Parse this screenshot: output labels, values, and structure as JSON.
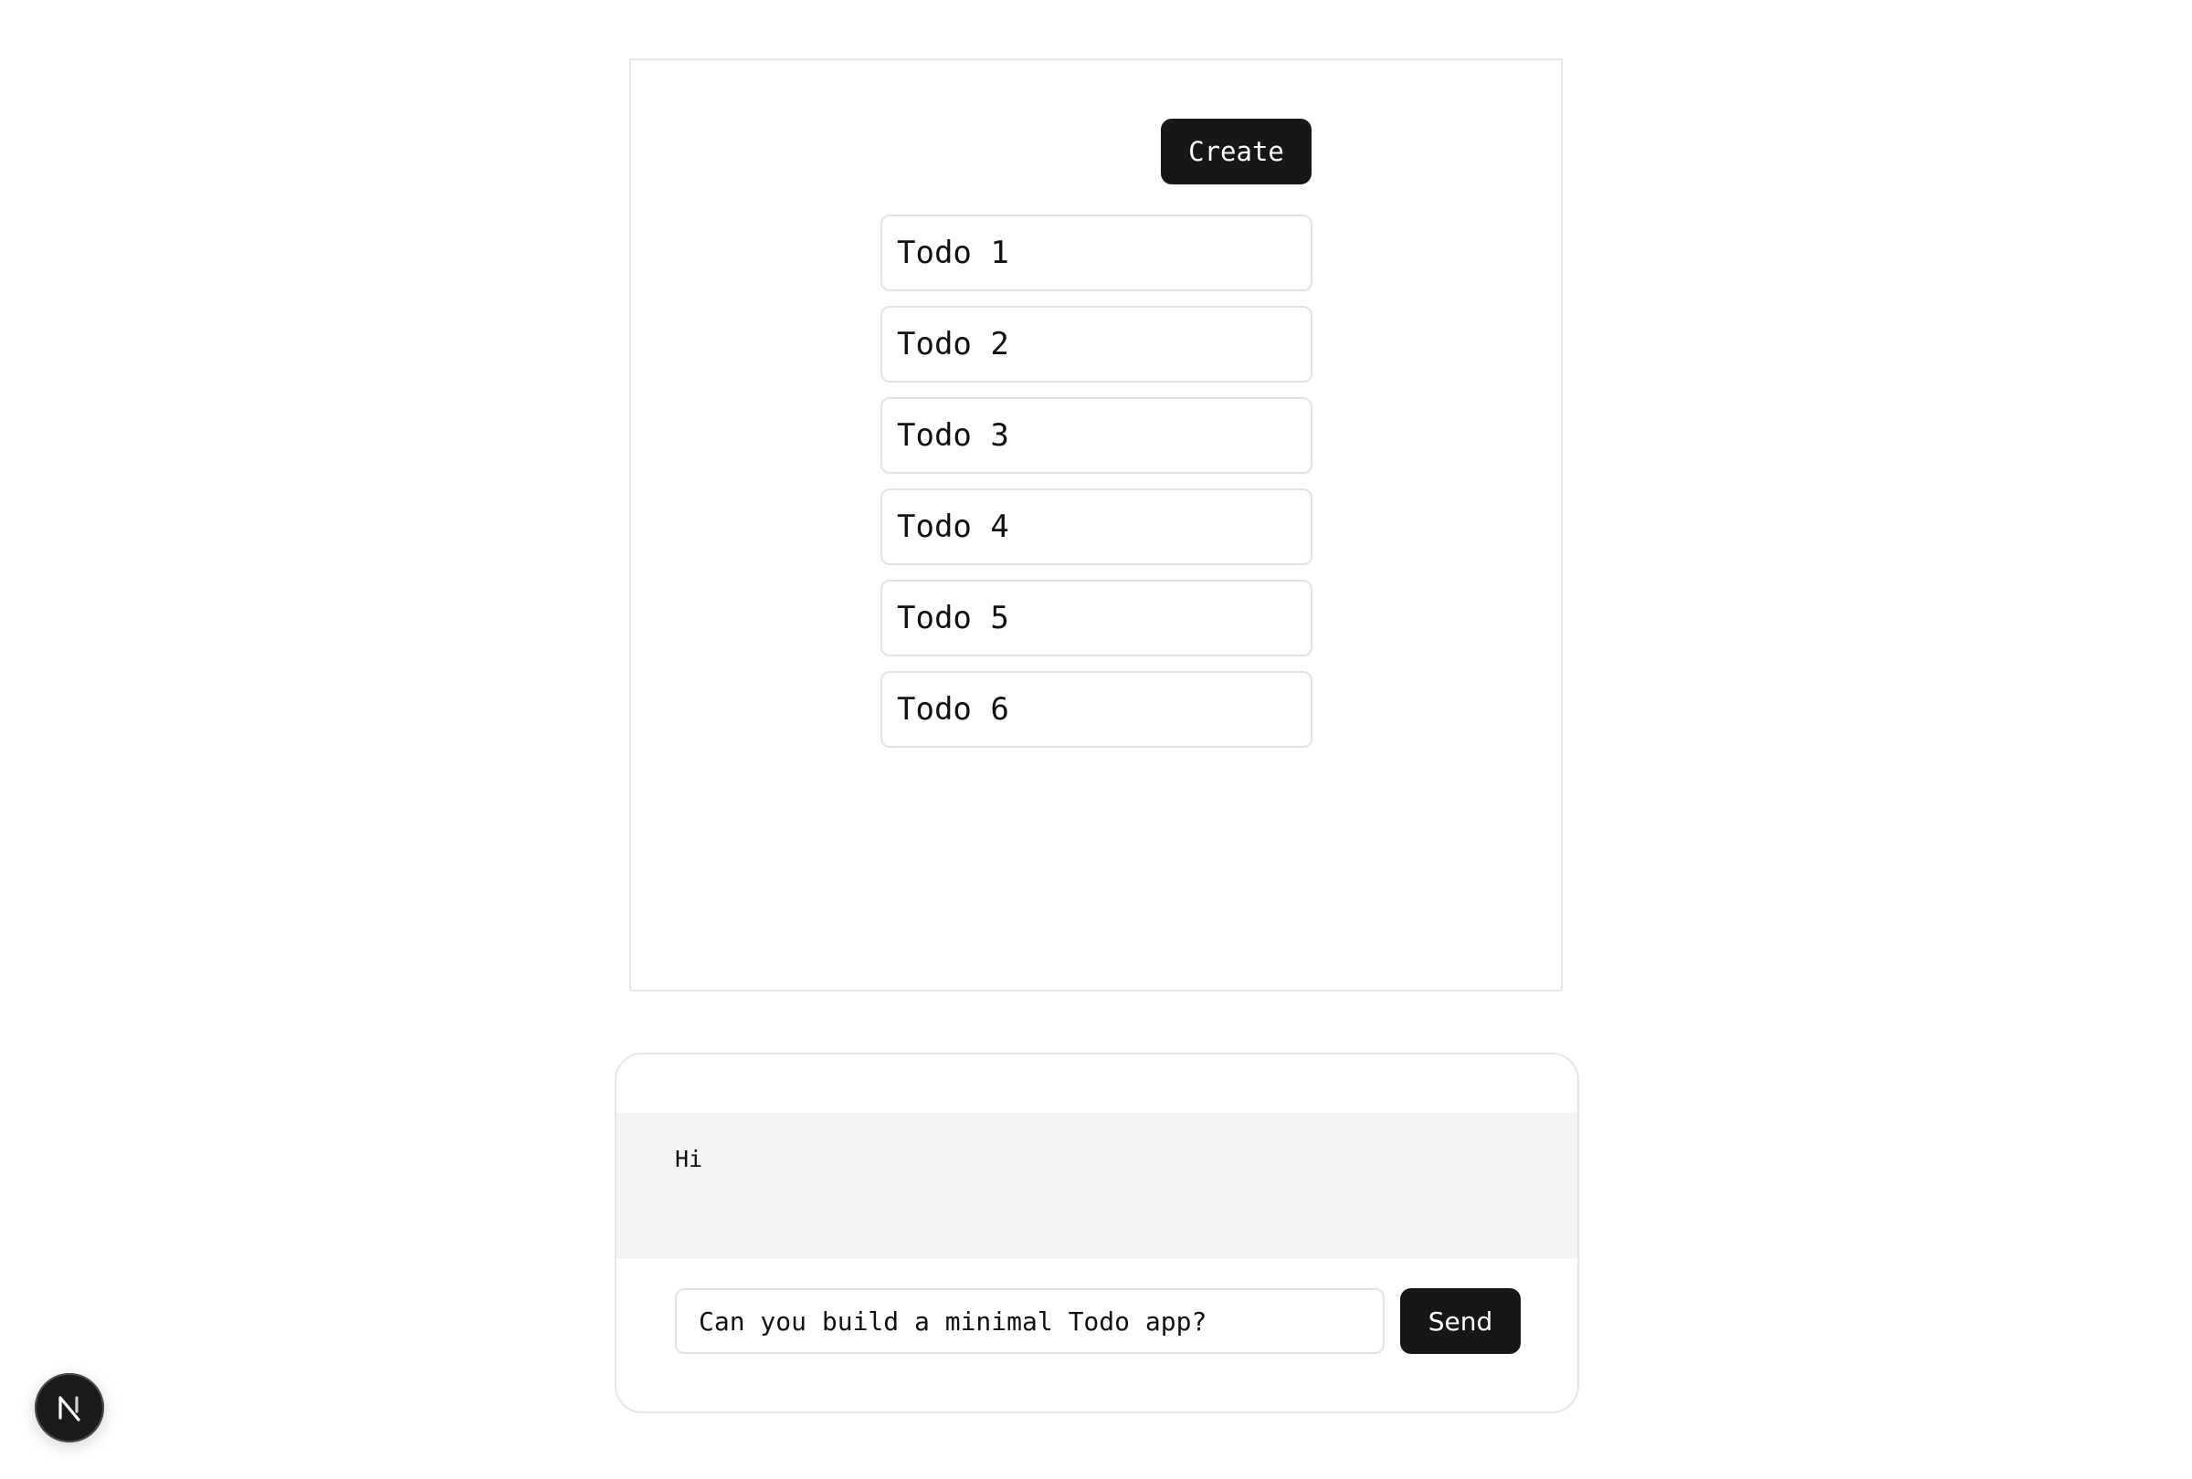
{
  "preview": {
    "create_label": "Create",
    "todos": [
      {
        "label": "Todo 1"
      },
      {
        "label": "Todo 2"
      },
      {
        "label": "Todo 3"
      },
      {
        "label": "Todo 4"
      },
      {
        "label": "Todo 5"
      },
      {
        "label": "Todo 6"
      }
    ]
  },
  "chat": {
    "messages": [
      {
        "text": "Hi"
      }
    ],
    "input_value": "Can you build a minimal Todo app?",
    "send_label": "Send"
  },
  "badge": {
    "letter": "N",
    "icon": "nextjs-logo-icon"
  },
  "colors": {
    "button_bg": "#171717",
    "message_bg": "#f3f4f5",
    "border": "#e6e6e6"
  }
}
